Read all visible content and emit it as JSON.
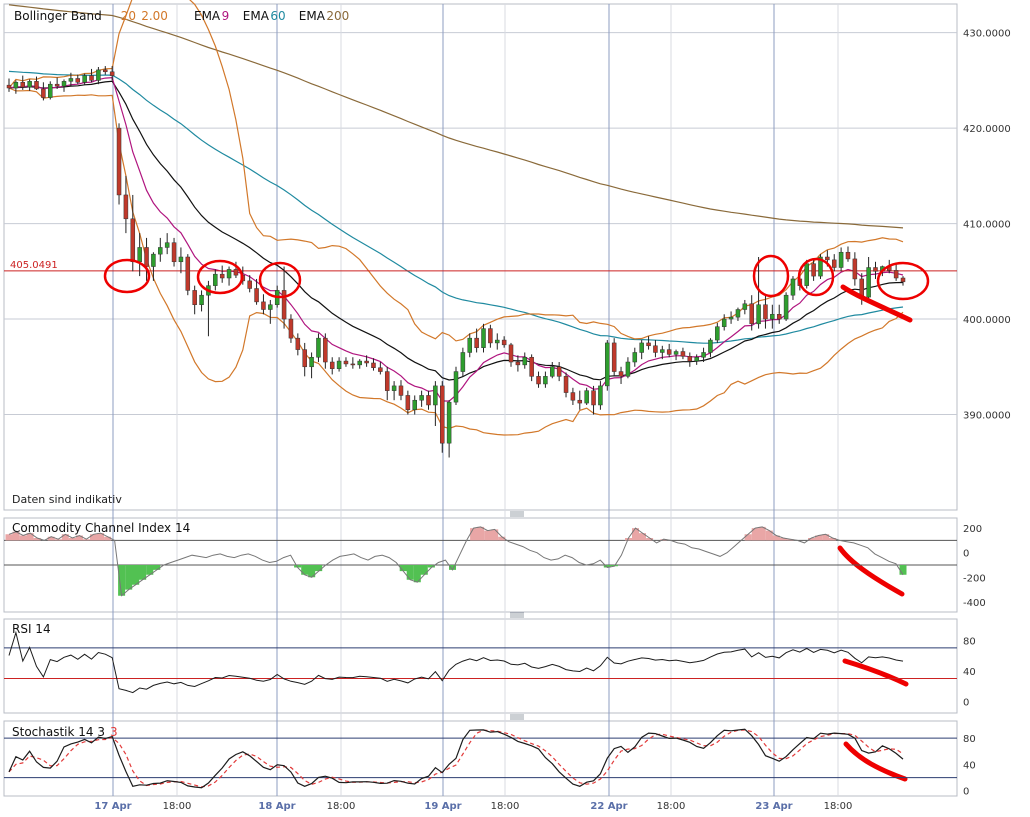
{
  "colors": {
    "up": "#2e9e2e",
    "down": "#c0392b",
    "wick": "#222222",
    "bb": "#d2782a",
    "ema9": "#b0157f",
    "ema60": "#1f8aa0",
    "ema200": "#8a6a3a",
    "ema20": "#111111",
    "hline": "#cc2222",
    "annot": "#ee0000",
    "grid": "#c7cbd4",
    "panel_border": "#b8bcc6",
    "cci_pos": "#e9a6a6",
    "cci_neg": "#52c152",
    "osc": "#1c1c1c",
    "level_hi": "#2c3d70",
    "level_lo": "#cc2222",
    "sig": "#e23b3b"
  },
  "price_panel": {
    "legend": [
      {
        "text": "Bollinger Band",
        "color": "#111111"
      },
      {
        "text": "20",
        "color": "#d2782a"
      },
      {
        "text": "2.00",
        "color": "#d2782a"
      },
      {
        "text": "EMA",
        "color": "#111111"
      },
      {
        "text": "9",
        "color": "#b0157f"
      },
      {
        "text": "EMA",
        "color": "#111111"
      },
      {
        "text": "60",
        "color": "#1f8aa0"
      },
      {
        "text": "EMA",
        "color": "#111111"
      },
      {
        "text": "200",
        "color": "#8a6a3a"
      }
    ],
    "disclaimer": "Daten sind indikativ",
    "price_marker": "405.0491",
    "y_ticks": [
      "430.0000",
      "420.0000",
      "410.0000",
      "400.0000",
      "390.0000"
    ]
  },
  "cci_panel": {
    "title": "Commodity Channel Index 14",
    "y_ticks": [
      "200",
      "0",
      "-200",
      "-400"
    ]
  },
  "rsi_panel": {
    "title": "RSI 14",
    "y_ticks": [
      "80",
      "40",
      "0"
    ]
  },
  "stoch_panel": {
    "title_main": "Stochastik 14 3",
    "title_sig": "3",
    "y_ticks": [
      "80",
      "40",
      "0"
    ]
  },
  "x_axis": {
    "labels": [
      "17 Apr",
      "18:00",
      "18 Apr",
      "18:00",
      "19 Apr",
      "18:00",
      "22 Apr",
      "18:00",
      "23 Apr",
      "18:00"
    ],
    "label_types": [
      "day",
      "time",
      "day",
      "time",
      "day",
      "time",
      "day",
      "time",
      "day",
      "time"
    ]
  },
  "chart_data": {
    "type": "candlestick",
    "x_labels": [
      "17 Apr",
      "18:00",
      "18 Apr",
      "18:00",
      "19 Apr",
      "18:00",
      "22 Apr",
      "18:00",
      "23 Apr",
      "18:00"
    ],
    "ylim": [
      380,
      433
    ],
    "reference_price": 405.0491,
    "candles_ohlc": [
      [
        424.5,
        425.2,
        423.8,
        424.2
      ],
      [
        424.2,
        425.0,
        423.6,
        424.8
      ],
      [
        424.8,
        425.5,
        424.0,
        424.3
      ],
      [
        424.3,
        425.1,
        423.9,
        424.9
      ],
      [
        424.9,
        425.4,
        424.0,
        424.1
      ],
      [
        424.1,
        424.8,
        422.9,
        423.2
      ],
      [
        423.2,
        424.9,
        423.0,
        424.6
      ],
      [
        424.6,
        425.3,
        424.1,
        424.4
      ],
      [
        424.4,
        425.1,
        423.8,
        424.9
      ],
      [
        424.9,
        425.8,
        424.4,
        425.2
      ],
      [
        425.2,
        425.6,
        424.6,
        424.8
      ],
      [
        424.8,
        425.7,
        424.5,
        425.5
      ],
      [
        425.5,
        426.2,
        424.8,
        425.0
      ],
      [
        425.0,
        426.4,
        424.6,
        426.1
      ],
      [
        426.1,
        426.5,
        425.6,
        425.9
      ],
      [
        425.9,
        426.5,
        425.0,
        425.5
      ],
      [
        420.0,
        420.5,
        412.0,
        413.0
      ],
      [
        413.0,
        415.0,
        409.0,
        410.5
      ],
      [
        410.5,
        413.0,
        405.0,
        406.0
      ],
      [
        406.0,
        409.0,
        404.5,
        407.5
      ],
      [
        407.5,
        408.5,
        404.0,
        405.5
      ],
      [
        405.5,
        407.0,
        404.0,
        406.8
      ],
      [
        406.8,
        408.5,
        406.0,
        407.5
      ],
      [
        407.5,
        409.0,
        406.8,
        408.0
      ],
      [
        408.0,
        408.5,
        405.5,
        406.0
      ],
      [
        406.0,
        407.5,
        404.8,
        406.5
      ],
      [
        406.5,
        406.8,
        402.5,
        403.0
      ],
      [
        403.0,
        403.5,
        400.5,
        401.5
      ],
      [
        401.5,
        403.0,
        400.8,
        402.5
      ],
      [
        402.5,
        404.0,
        398.2,
        403.5
      ],
      [
        403.5,
        405.2,
        403.0,
        404.7
      ],
      [
        404.7,
        405.6,
        403.8,
        404.3
      ],
      [
        404.3,
        405.5,
        403.5,
        405.2
      ],
      [
        405.2,
        406.0,
        404.3,
        404.6
      ],
      [
        404.6,
        405.5,
        403.6,
        404.0
      ],
      [
        404.0,
        404.6,
        402.8,
        403.2
      ],
      [
        403.2,
        404.2,
        401.5,
        401.8
      ],
      [
        401.8,
        402.6,
        400.5,
        401.0
      ],
      [
        401.0,
        402.0,
        399.5,
        401.5
      ],
      [
        401.5,
        403.5,
        401.2,
        403.0
      ],
      [
        403.0,
        405.5,
        399.0,
        400.0
      ],
      [
        400.0,
        400.5,
        397.5,
        398.0
      ],
      [
        398.0,
        398.5,
        396.2,
        396.8
      ],
      [
        396.8,
        397.5,
        394.0,
        395.0
      ],
      [
        395.0,
        396.5,
        393.8,
        396.0
      ],
      [
        396.0,
        398.5,
        395.5,
        398.0
      ],
      [
        398.0,
        398.5,
        394.8,
        395.5
      ],
      [
        395.5,
        396.0,
        394.2,
        394.8
      ],
      [
        394.8,
        396.0,
        394.5,
        395.6
      ],
      [
        395.6,
        396.0,
        395.0,
        395.3
      ],
      [
        395.3,
        396.0,
        394.8,
        395.2
      ],
      [
        395.2,
        395.8,
        394.8,
        395.6
      ],
      [
        395.6,
        396.2,
        395.0,
        395.4
      ],
      [
        395.4,
        395.9,
        394.6,
        394.9
      ],
      [
        394.9,
        395.5,
        394.2,
        394.5
      ],
      [
        394.5,
        395.0,
        391.5,
        392.5
      ],
      [
        392.5,
        393.5,
        391.5,
        393.0
      ],
      [
        393.0,
        393.6,
        391.5,
        392.0
      ],
      [
        392.0,
        392.5,
        390.0,
        390.5
      ],
      [
        390.5,
        392.0,
        390.0,
        391.5
      ],
      [
        391.5,
        392.5,
        390.8,
        392.0
      ],
      [
        392.0,
        392.5,
        390.5,
        391.0
      ],
      [
        391.0,
        393.5,
        388.8,
        393.0
      ],
      [
        393.0,
        393.5,
        386.0,
        387.0
      ],
      [
        387.0,
        391.5,
        385.5,
        391.3
      ],
      [
        391.3,
        395.0,
        391.0,
        394.5
      ],
      [
        394.5,
        397.0,
        394.0,
        396.5
      ],
      [
        396.5,
        398.5,
        396.0,
        398.0
      ],
      [
        398.0,
        399.0,
        396.5,
        397.0
      ],
      [
        397.0,
        399.5,
        396.5,
        399.0
      ],
      [
        399.0,
        399.4,
        397.0,
        397.5
      ],
      [
        397.5,
        398.5,
        396.8,
        397.8
      ],
      [
        397.8,
        398.2,
        397.0,
        397.3
      ],
      [
        397.3,
        397.5,
        395.0,
        395.5
      ],
      [
        395.5,
        396.2,
        394.5,
        395.2
      ],
      [
        395.2,
        396.5,
        394.8,
        396.0
      ],
      [
        396.0,
        396.3,
        393.5,
        394.0
      ],
      [
        394.0,
        394.5,
        392.8,
        393.2
      ],
      [
        393.2,
        394.5,
        392.8,
        394.0
      ],
      [
        394.0,
        395.5,
        393.8,
        395.0
      ],
      [
        395.0,
        395.5,
        393.5,
        394.0
      ],
      [
        394.0,
        394.4,
        391.8,
        392.3
      ],
      [
        392.3,
        392.8,
        391.0,
        391.5
      ],
      [
        391.5,
        392.5,
        390.5,
        391.2
      ],
      [
        391.2,
        392.8,
        391.0,
        392.5
      ],
      [
        392.5,
        393.0,
        390.0,
        391.0
      ],
      [
        391.0,
        393.5,
        390.5,
        393.0
      ],
      [
        393.0,
        397.8,
        392.5,
        397.5
      ],
      [
        397.5,
        398.0,
        394.0,
        394.5
      ],
      [
        394.5,
        395.0,
        393.2,
        394.0
      ],
      [
        394.0,
        396.0,
        393.8,
        395.5
      ],
      [
        395.5,
        397.0,
        395.0,
        396.5
      ],
      [
        396.5,
        397.8,
        395.8,
        397.5
      ],
      [
        397.5,
        398.2,
        396.8,
        397.2
      ],
      [
        397.2,
        397.8,
        396.0,
        396.5
      ],
      [
        396.5,
        397.2,
        395.8,
        396.8
      ],
      [
        396.8,
        397.4,
        396.0,
        396.3
      ],
      [
        396.3,
        396.8,
        395.7,
        396.6
      ],
      [
        396.6,
        397.0,
        395.8,
        396.1
      ],
      [
        396.1,
        396.5,
        395.0,
        395.6
      ],
      [
        395.6,
        396.3,
        395.2,
        396.0
      ],
      [
        396.0,
        397.0,
        395.5,
        396.5
      ],
      [
        396.5,
        398.0,
        396.0,
        397.8
      ],
      [
        397.8,
        399.6,
        397.5,
        399.2
      ],
      [
        399.2,
        400.5,
        398.8,
        400.0
      ],
      [
        400.0,
        400.8,
        399.5,
        400.2
      ],
      [
        400.2,
        401.2,
        399.8,
        401.0
      ],
      [
        401.0,
        402.0,
        400.5,
        401.6
      ],
      [
        401.6,
        402.5,
        398.8,
        399.5
      ],
      [
        399.5,
        406.5,
        399.0,
        401.5
      ],
      [
        401.5,
        402.5,
        399.0,
        400.0
      ],
      [
        400.0,
        401.5,
        399.0,
        400.5
      ],
      [
        400.5,
        401.5,
        399.5,
        400.0
      ],
      [
        400.0,
        402.8,
        399.8,
        402.5
      ],
      [
        402.5,
        404.5,
        402.0,
        404.2
      ],
      [
        404.2,
        404.8,
        403.0,
        403.5
      ],
      [
        403.5,
        406.2,
        403.2,
        405.8
      ],
      [
        405.8,
        406.3,
        404.0,
        404.5
      ],
      [
        404.5,
        406.8,
        404.2,
        406.5
      ],
      [
        406.5,
        407.2,
        405.5,
        406.2
      ],
      [
        406.2,
        406.8,
        405.0,
        405.4
      ],
      [
        405.4,
        407.5,
        405.0,
        407.0
      ],
      [
        407.0,
        407.6,
        406.0,
        406.3
      ],
      [
        406.3,
        407.0,
        403.5,
        404.2
      ],
      [
        404.2,
        404.8,
        401.5,
        402.3
      ],
      [
        402.3,
        406.5,
        402.0,
        405.4
      ],
      [
        405.4,
        406.0,
        404.2,
        405.0
      ],
      [
        405.0,
        405.6,
        404.5,
        405.5
      ],
      [
        405.5,
        406.2,
        404.8,
        405.1
      ],
      [
        405.1,
        405.8,
        404.0,
        404.3
      ],
      [
        404.3,
        404.5,
        403.5,
        403.9
      ]
    ],
    "day_boundaries": [
      16,
      40,
      64,
      88,
      112
    ],
    "cci": [
      150,
      170,
      140,
      160,
      120,
      100,
      130,
      110,
      150,
      120,
      140,
      110,
      150,
      160,
      130,
      100,
      -350,
      -300,
      -260,
      -220,
      -180,
      -140,
      -100,
      -80,
      -60,
      -40,
      -20,
      -30,
      -40,
      -20,
      -10,
      -30,
      -40,
      -20,
      -10,
      -30,
      -60,
      -80,
      -70,
      -40,
      -20,
      -120,
      -180,
      -200,
      -150,
      -100,
      -60,
      -30,
      -20,
      -10,
      -40,
      -60,
      -30,
      -20,
      -40,
      -80,
      -150,
      -220,
      -240,
      -180,
      -120,
      -80,
      -60,
      -140,
      -20,
      100,
      200,
      210,
      180,
      190,
      130,
      90,
      70,
      50,
      20,
      0,
      -40,
      -60,
      -50,
      -20,
      -40,
      -80,
      -100,
      -90,
      -60,
      -120,
      -110,
      -20,
      120,
      200,
      160,
      120,
      80,
      110,
      100,
      80,
      70,
      40,
      30,
      10,
      -10,
      -30,
      0,
      50,
      100,
      150,
      200,
      210,
      180,
      140,
      120,
      110,
      100,
      80,
      120,
      140,
      150,
      120,
      100,
      90,
      80,
      60,
      40,
      -10,
      -40,
      -70,
      -90,
      -180
    ]
  }
}
